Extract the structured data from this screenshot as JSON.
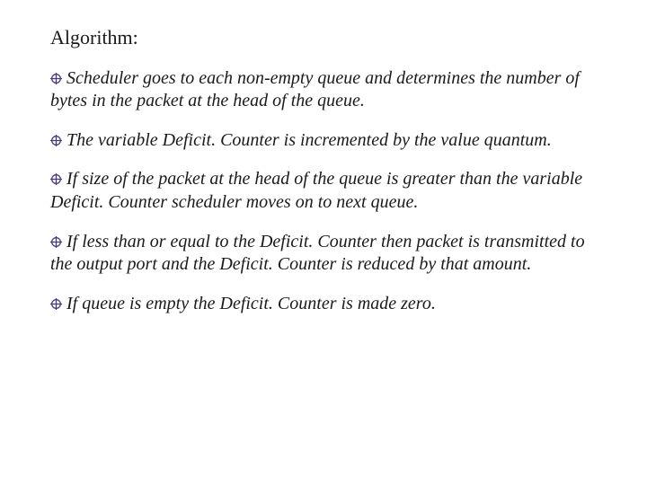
{
  "title": "Algorithm:",
  "bullets": [
    "Scheduler goes to each non-empty queue and determines the number of bytes in the packet at the head of the queue.",
    "The variable Deficit. Counter is incremented by the value quantum.",
    "If size of the packet at the head of the queue is greater than the variable Deficit. Counter scheduler moves on to next queue.",
    "If less than or equal to the Deficit. Counter then packet is transmitted to the output port and the Deficit. Counter is reduced by that amount.",
    "If queue is empty the Deficit. Counter is made zero."
  ],
  "bullet_color": "#4b3a7a"
}
